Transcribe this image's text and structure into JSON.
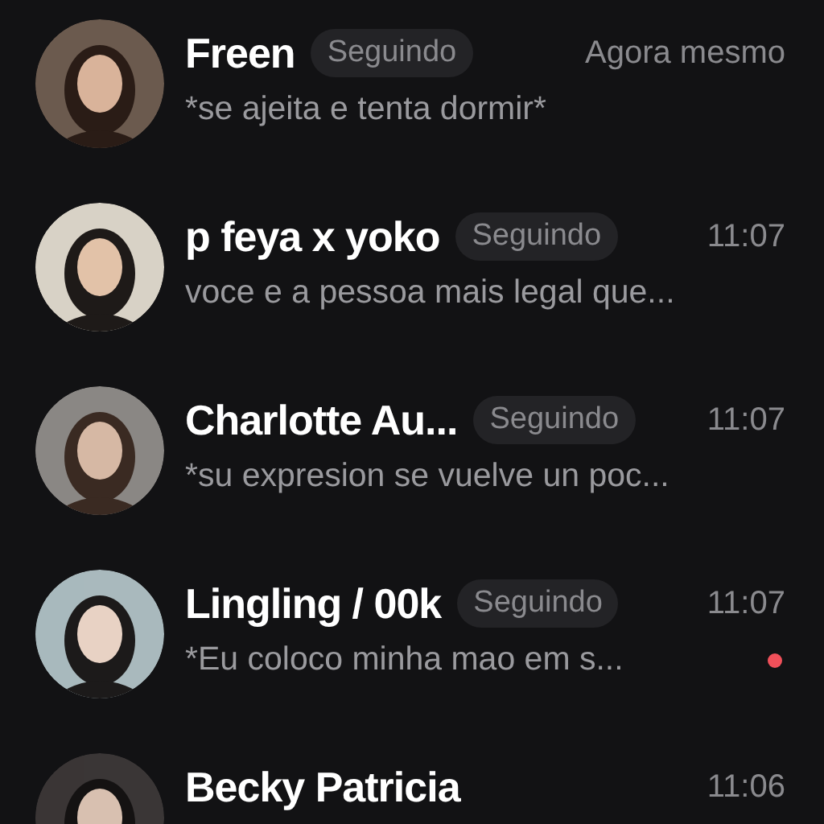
{
  "chats": [
    {
      "name": "Freen",
      "badge": "Seguindo",
      "time": "Agora mesmo",
      "message": "*se ajeita e tenta dormir*",
      "unread": false
    },
    {
      "name": "p feya x yoko",
      "badge": "Seguindo",
      "time": "11:07",
      "message": "voce e a pessoa mais legal que...",
      "unread": false
    },
    {
      "name": "Charlotte Au...",
      "badge": "Seguindo",
      "time": "11:07",
      "message": "*su expresion se vuelve un poc...",
      "unread": false
    },
    {
      "name": "Lingling / 00k",
      "badge": "Seguindo",
      "time": "11:07",
      "message": "*Eu coloco minha mao em s...",
      "unread": true
    },
    {
      "name": "Becky Patricia",
      "time": "11:06",
      "unread": false
    }
  ]
}
